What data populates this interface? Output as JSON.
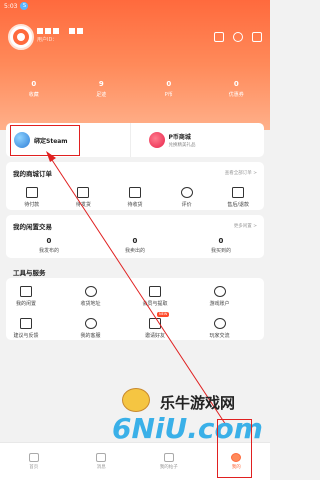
{
  "status": {
    "time": "5:03",
    "badge": "S"
  },
  "profile": {
    "user_id_prefix": "用户ID：",
    "icons": [
      "scan-icon",
      "settings-icon",
      "message-icon"
    ]
  },
  "stats": [
    {
      "value": "0",
      "label": "收藏"
    },
    {
      "value": "9",
      "label": "足迹"
    },
    {
      "value": "0",
      "label": "P币"
    },
    {
      "value": "0",
      "label": "优惠券"
    }
  ],
  "promo": {
    "steam_label": "绑定Steam",
    "pmall_title": "P币商城",
    "pmall_sub": "兑换精美礼品"
  },
  "orders": {
    "title": "我的商城订单",
    "more": "查看全部订单 >",
    "items": [
      {
        "label": "待付款",
        "icon": "wallet-icon"
      },
      {
        "label": "待发货",
        "icon": "package-icon"
      },
      {
        "label": "待收货",
        "icon": "truck-icon"
      },
      {
        "label": "评价",
        "icon": "review-icon"
      },
      {
        "label": "售后/退款",
        "icon": "refund-icon"
      }
    ]
  },
  "trade": {
    "title": "我的闲置交易",
    "more": "更多闲置 >",
    "items": [
      {
        "value": "0",
        "label": "我发布的"
      },
      {
        "value": "0",
        "label": "我卖出的"
      },
      {
        "value": "0",
        "label": "我买到的"
      }
    ]
  },
  "tools": {
    "title": "工具与服务",
    "items": [
      {
        "label": "我的闲置",
        "icon": "bag-icon"
      },
      {
        "label": "收货地址",
        "icon": "location-icon"
      },
      {
        "label": "会员与提取",
        "icon": "member-icon"
      },
      {
        "label": "游戏账户",
        "icon": "account-icon"
      },
      {
        "label": "建议与反馈",
        "icon": "feedback-icon"
      },
      {
        "label": "我的客服",
        "icon": "service-icon"
      },
      {
        "label": "邀请好友",
        "icon": "gift-icon",
        "tag": "NEW"
      },
      {
        "label": "玩家交流",
        "icon": "chat-icon"
      }
    ]
  },
  "watermark": {
    "text": "乐牛游戏网",
    "logo": "6NiU.com"
  },
  "tabs": [
    {
      "label": "首页",
      "icon": "home-icon"
    },
    {
      "label": "消息",
      "icon": "message-tab-icon"
    },
    {
      "label": "我的帖子",
      "icon": "post-icon"
    },
    {
      "label": "我的",
      "icon": "profile-icon"
    }
  ]
}
